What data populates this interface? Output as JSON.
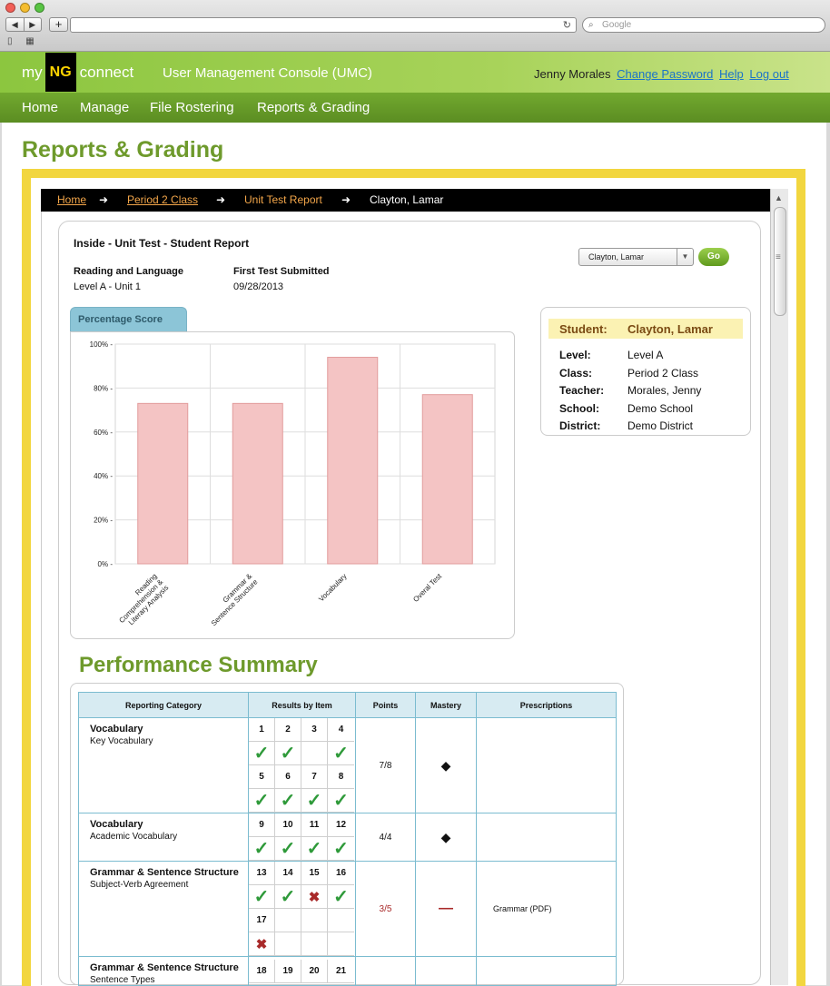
{
  "browser": {
    "search_placeholder": "Google",
    "back": "◀",
    "forward": "▶",
    "new_tab": "+",
    "reload": "↻"
  },
  "header": {
    "logo_left": "my",
    "logo_mid": "NG",
    "logo_right": "connect",
    "app_title": "User Management Console (UMC)",
    "user_name": "Jenny Morales",
    "links": [
      "Change Password",
      "Help",
      "Log out"
    ]
  },
  "nav": [
    "Home",
    "Manage",
    "File Rostering",
    "Reports & Grading"
  ],
  "page_title": "Reports & Grading",
  "breadcrumb": {
    "items": [
      "Home",
      "Period 2 Class",
      "Unit Test Report",
      "Clayton, Lamar"
    ]
  },
  "report": {
    "title": "Inside - Unit Test - Student Report",
    "course": "Reading and Language",
    "level_unit": "Level A - Unit 1",
    "submitted_label": "First Test Submitted",
    "submitted_date": "09/28/2013",
    "student_select": "Clayton, Lamar",
    "go_label": "Go",
    "tab_label": "Percentage Score"
  },
  "student_card": {
    "student_label": "Student:",
    "student_value": "Clayton, Lamar",
    "rows": [
      {
        "label": "Level:",
        "value": "Level A"
      },
      {
        "label": "Class:",
        "value": "Period 2 Class"
      },
      {
        "label": "Teacher:",
        "value": "Morales, Jenny"
      },
      {
        "label": "School:",
        "value": "Demo School"
      },
      {
        "label": "District:",
        "value": "Demo District"
      }
    ]
  },
  "chart_data": {
    "type": "bar",
    "categories": [
      "Reading Comprehension & Literary Analysis",
      "Grammar & Sentence Structure",
      "Vocabulary",
      "Overal Test"
    ],
    "category_lines": [
      [
        "Reading",
        "Comprehension &",
        "Literary Analysis"
      ],
      [
        "Grammar &",
        "Sentence Structure"
      ],
      [
        "Vocabulary"
      ],
      [
        "Overal Test"
      ]
    ],
    "values": [
      73,
      73,
      94,
      77
    ],
    "yticks": [
      "100% -",
      "80% -",
      "60% -",
      "40% -",
      "20% -",
      "0% -"
    ],
    "ylim": [
      0,
      100
    ],
    "grid": true,
    "bar_color": "#f4c4c4",
    "bar_stroke": "#e29c9c"
  },
  "performance": {
    "title": "Performance Summary",
    "columns": [
      "Reporting Category",
      "Results by Item",
      "Points",
      "Mastery",
      "Prescriptions"
    ],
    "rows": [
      {
        "cat": "Vocabulary",
        "sub": "Key Vocabulary",
        "items": [
          [
            "1",
            "ok"
          ],
          [
            "2",
            "ok"
          ],
          [
            "3",
            ""
          ],
          [
            "4",
            "ok"
          ],
          [
            "5",
            "ok"
          ],
          [
            "6",
            "ok"
          ],
          [
            "7",
            "ok"
          ],
          [
            "8",
            "ok"
          ]
        ],
        "points": "7/8",
        "mastery": "◆",
        "prescription": ""
      },
      {
        "cat": "Vocabulary",
        "sub": "Academic Vocabulary",
        "items": [
          [
            "9",
            "ok"
          ],
          [
            "10",
            "ok"
          ],
          [
            "11",
            "ok"
          ],
          [
            "12",
            "ok"
          ]
        ],
        "points": "4/4",
        "mastery": "◆",
        "prescription": ""
      },
      {
        "cat": "Grammar & Sentence Structure",
        "sub": "Subject-Verb Agreement",
        "items": [
          [
            "13",
            "ok"
          ],
          [
            "14",
            "ok"
          ],
          [
            "15",
            "bad"
          ],
          [
            "16",
            "ok"
          ],
          [
            "17",
            "bad"
          ]
        ],
        "points": "3/5",
        "mastery": "—",
        "prescription": "Grammar (PDF)"
      },
      {
        "cat": "Grammar & Sentence Structure",
        "sub": "Sentence Types",
        "items": [
          [
            "18",
            ""
          ],
          [
            "19",
            ""
          ],
          [
            "20",
            ""
          ],
          [
            "21",
            ""
          ]
        ],
        "points": "",
        "mastery": "",
        "prescription": ""
      }
    ],
    "check_glyph": "✓",
    "cross_glyph": "✖"
  }
}
